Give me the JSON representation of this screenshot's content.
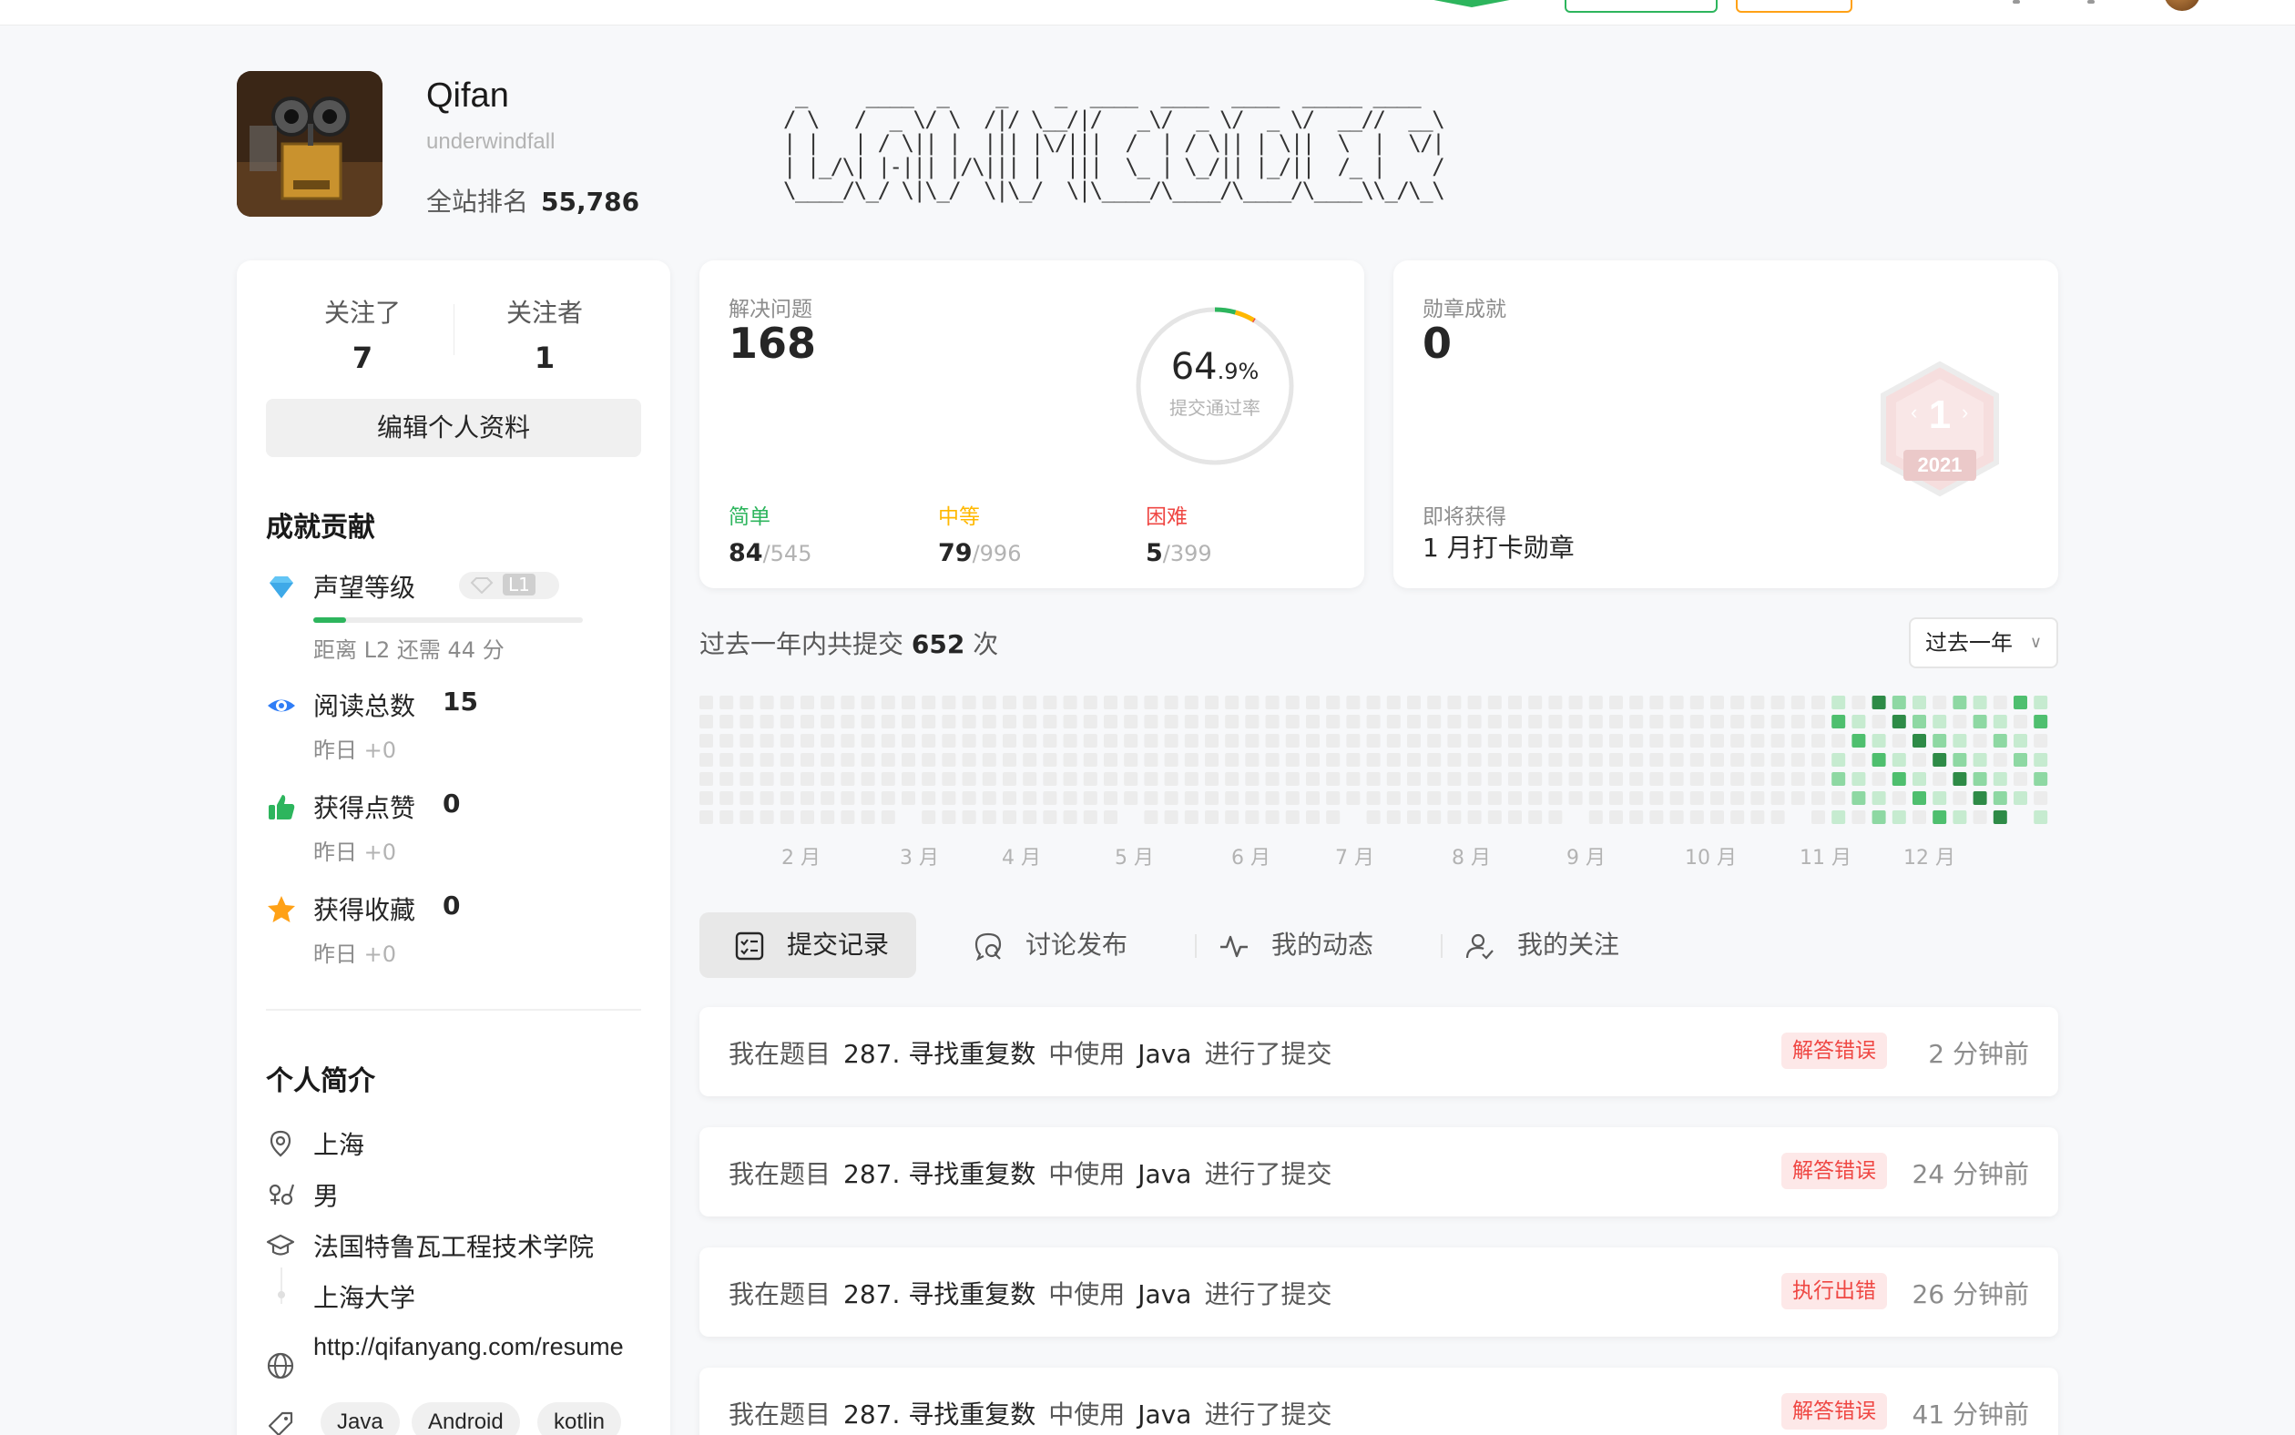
{
  "profile": {
    "name": "Qifan",
    "handle": "underwindfall",
    "rank_label": "全站排名",
    "rank_value": "55,786",
    "following_label": "关注了",
    "following_count": "7",
    "followers_label": "关注者",
    "followers_count": "1",
    "edit_label": "编辑个人资料"
  },
  "achievements": {
    "title": "成就贡献",
    "reputation_label": "声望等级",
    "level_badge": "L1",
    "level_progress": 0.12,
    "level_hint": "距离 L2 还需 44 分",
    "reads_label": "阅读总数",
    "reads_value": "15",
    "likes_label": "获得点赞",
    "likes_value": "0",
    "favs_label": "获得收藏",
    "favs_value": "0",
    "yesterday_label": "昨日",
    "yesterday_value": "+0"
  },
  "bio": {
    "title": "个人简介",
    "location": "上海",
    "gender": "男",
    "school1": "法国特鲁瓦工程技术学院",
    "school2": "上海大学",
    "url": "http://qifanyang.com/resume",
    "tags": [
      "Java",
      "Android",
      "kotlin"
    ]
  },
  "solved": {
    "label": "解决问题",
    "count": "168",
    "rate_int": "64",
    "rate_dec": ".9%",
    "rate_label": "提交通过率",
    "rate_value": 0.649,
    "easy_label": "简单",
    "easy_done": "84",
    "easy_total": "/545",
    "medium_label": "中等",
    "medium_done": "79",
    "medium_total": "/996",
    "hard_label": "困难",
    "hard_done": "5",
    "hard_total": "/399"
  },
  "badges": {
    "label": "勋章成就",
    "count": "0",
    "next_label": "即将获得",
    "next_value": "1 月打卡勋章",
    "hex_number": "1",
    "hex_year": "2021"
  },
  "submissions": {
    "summary_prefix": "过去一年内共提交",
    "summary_count": "652",
    "summary_suffix": "次",
    "period": "过去一年",
    "months": [
      "2 月",
      "3 月",
      "4 月",
      "5 月",
      "6 月",
      "7 月",
      "8 月",
      "9 月",
      "10 月",
      "11 月",
      "12 月"
    ]
  },
  "tabs": [
    "提交记录",
    "讨论发布",
    "我的动态",
    "我的关注"
  ],
  "records": [
    {
      "prefix": "我在题目",
      "problem": "287. 寻找重复数",
      "mid": "中使用",
      "lang": "Java",
      "suffix": "进行了提交",
      "status": "解答错误",
      "time": "2 分钟前"
    },
    {
      "prefix": "我在题目",
      "problem": "287. 寻找重复数",
      "mid": "中使用",
      "lang": "Java",
      "suffix": "进行了提交",
      "status": "解答错误",
      "time": "24 分钟前"
    },
    {
      "prefix": "我在题目",
      "problem": "287. 寻找重复数",
      "mid": "中使用",
      "lang": "Java",
      "suffix": "进行了提交",
      "status": "执行出错",
      "time": "26 分钟前"
    },
    {
      "prefix": "我在题目",
      "problem": "287. 寻找重复数",
      "mid": "中使用",
      "lang": "Java",
      "suffix": "进行了提交",
      "status": "解答错误",
      "time": "41 分钟前"
    }
  ],
  "colors": {
    "easy": "#2db55d",
    "medium": "#ffb800",
    "hard": "#ef4743",
    "accent": "#2db55d"
  }
}
